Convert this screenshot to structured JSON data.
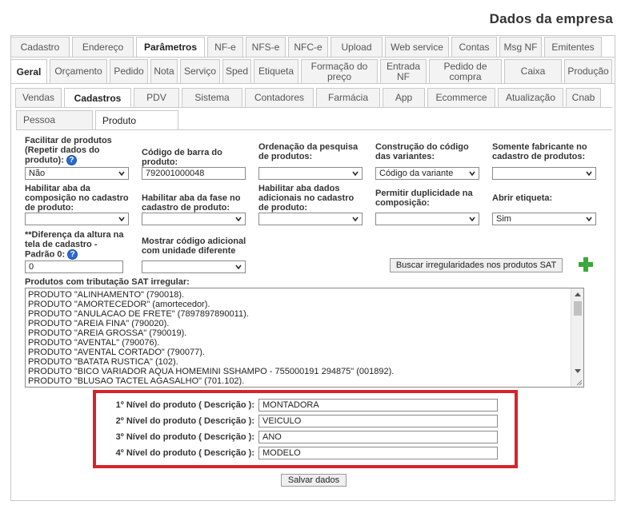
{
  "page": {
    "title": "Dados da empresa"
  },
  "tabs_row1": [
    "Cadastro",
    "Endereço",
    "Parâmetros",
    "NF-e",
    "NFS-e",
    "NFC-e",
    "Upload",
    "Web service",
    "Contas",
    "Msg NF",
    "Emitentes"
  ],
  "tabs_row2": [
    "Geral",
    "Orçamento",
    "Pedido",
    "Nota",
    "Serviço",
    "Sped",
    "Etiqueta",
    "Formação do preço",
    "Entrada NF",
    "Pedido de compra",
    "Caixa",
    "Produção"
  ],
  "tabs_row3": [
    "Vendas",
    "Cadastros",
    "PDV",
    "Sistema",
    "Contadores",
    "Farmácia",
    "App",
    "Ecommerce",
    "Atualização",
    "Cnab"
  ],
  "tabs_row4": [
    "Pessoa",
    "Produto"
  ],
  "fields": {
    "facilitar_label": "Facilitar de produtos (Repetir dados do produto):",
    "facilitar_value": "Não",
    "codigo_barra_label": "Código de barra do produto:",
    "codigo_barra_value": "792001000048",
    "ordenacao_label": "Ordenação da pesquisa de produtos:",
    "ordenacao_value": "",
    "construcao_label": "Construção do código das variantes:",
    "construcao_value": "Código da variante",
    "somente_fabricante_label": "Somente fabricante no cadastro de produtos:",
    "somente_fabricante_value": "",
    "aba_composicao_label": "Habilitar aba da composição no cadastro de produto:",
    "aba_composicao_value": "",
    "aba_fase_label": "Habilitar aba da fase no cadastro de produto:",
    "aba_fase_value": "",
    "aba_adicionais_label": "Habilitar aba dados adicionais no cadastro de produto:",
    "aba_adicionais_value": "",
    "duplicidade_label": "Permitir duplicidade na composição:",
    "duplicidade_value": "",
    "abrir_etiqueta_label": "Abrir etiqueta:",
    "abrir_etiqueta_value": "Sim",
    "diferenca_altura_label": "**Diferença da altura na tela de cadastro - Padrão 0:",
    "diferenca_altura_value": "0",
    "codigo_adicional_label": "Mostrar código adicional com unidade diferente",
    "codigo_adicional_value": ""
  },
  "buttons": {
    "buscar": "Buscar irregularidades nos produtos SAT",
    "salvar": "Salvar dados"
  },
  "sat": {
    "label": "Produtos com tributação SAT irregular:",
    "items": [
      "PRODUTO \"ALINHAMENTO\" (790018).",
      "PRODUTO \"AMORTECEDOR\" (amortecedor).",
      "PRODUTO \"ANULACAO DE FRETE\" (7897897890011).",
      "PRODUTO \"AREIA FINA\" (790020).",
      "PRODUTO \"AREIA GROSSA\" (790019).",
      "PRODUTO \"AVENTAL\" (790076).",
      "PRODUTO \"AVENTAL CORTADO\" (790077).",
      "PRODUTO \"BATATA RUSTICA\" (102).",
      "PRODUTO \"BICO VARIADOR AQUA HOMEMINI SSHAMPO - 755000191 294875\" (001892).",
      "PRODUTO \"BLUSAO TACTEL AGASALHO\" (701.102)."
    ]
  },
  "levels": [
    {
      "label": "1º Nível do produto ( Descrição ):",
      "value": "MONTADORA"
    },
    {
      "label": "2º Nível do produto ( Descrição ):",
      "value": "VEICULO"
    },
    {
      "label": "3º Nível do produto ( Descrição ):",
      "value": "ANO"
    },
    {
      "label": "4º Nível do produto ( Descrição ):",
      "value": "MODELO"
    }
  ],
  "icons": {
    "help": "help-icon",
    "add": "plus-icon",
    "dropdown": "chevron-down-icon"
  },
  "colors": {
    "highlight": "#d8232a",
    "help": "#2a6ad0",
    "add": "#3aa83a"
  }
}
